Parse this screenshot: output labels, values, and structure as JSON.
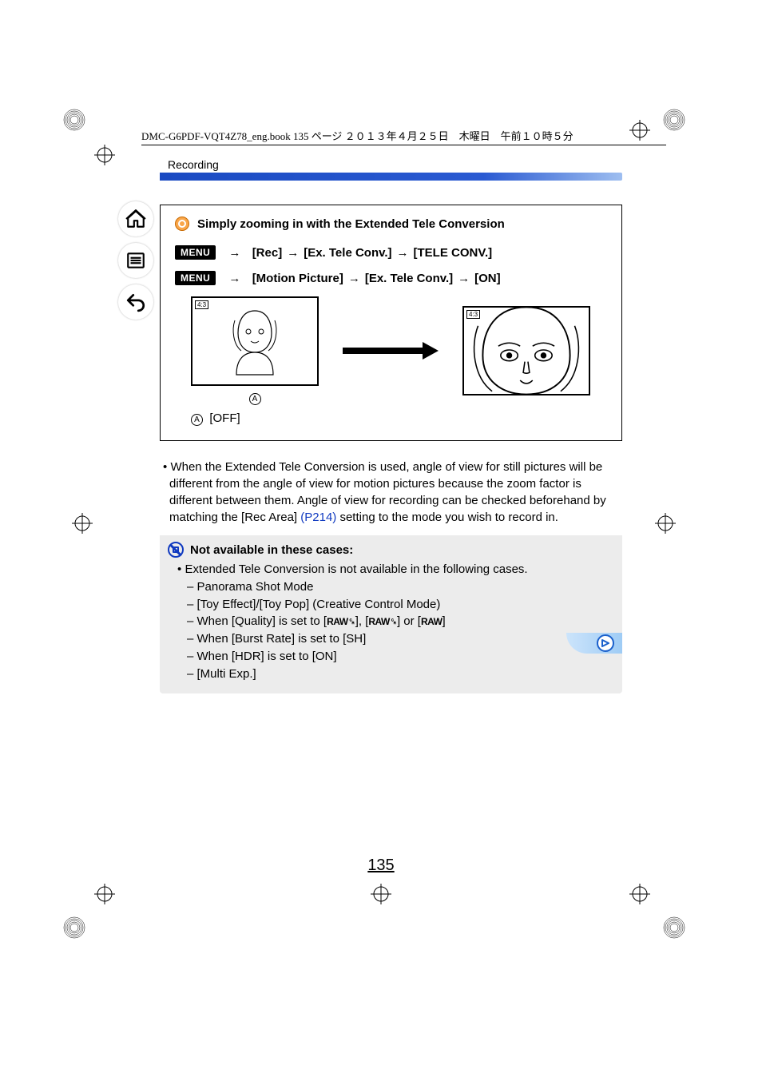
{
  "header_meta": "DMC-G6PDF-VQT4Z78_eng.book  135 ページ  ２０１３年４月２５日　木曜日　午前１０時５分",
  "section_label": "Recording",
  "box": {
    "title": "Simply zooming in with the Extended Tele Conversion",
    "menu_badge": "MENU",
    "arrow": "→",
    "path_rec": [
      "[Rec]",
      "[Ex. Tele Conv.]",
      "[TELE CONV.]"
    ],
    "path_motion": [
      "[Motion Picture]",
      "[Ex. Tele Conv.]",
      "[ON]"
    ],
    "aspect_a": "4:3",
    "aspect_b": "4:3",
    "marker": "A",
    "marker_label": "[OFF]"
  },
  "body_note": {
    "bullet": "•",
    "text_pre": "When the Extended Tele Conversion is used, angle of view for still pictures will be different from the angle of view for motion pictures because the zoom factor is different between them. Angle of view for recording can be checked beforehand by matching the [Rec Area] ",
    "link": "(P214)",
    "text_post": " setting to the mode you wish to record in."
  },
  "not_available": {
    "title": "Not available in these cases:",
    "lead_bullet": "•",
    "lead": "Extended Tele Conversion is not available in the following cases.",
    "dash": "–",
    "items": {
      "i0": "Panorama Shot Mode",
      "i1": "[Toy Effect]/[Toy Pop] (Creative Control Mode)",
      "i2_pre": "When [Quality] is set to [",
      "i2_a": "RAW␍",
      "i2_mid1": "], [",
      "i2_b": "RAW␍",
      "i2_mid2": "] or [",
      "i2_c": "RAW",
      "i2_post": "]",
      "i3": "When [Burst Rate] is set to [SH]",
      "i4": "When [HDR] is set to [ON]",
      "i5": "[Multi Exp.]"
    }
  },
  "page_number": "135"
}
